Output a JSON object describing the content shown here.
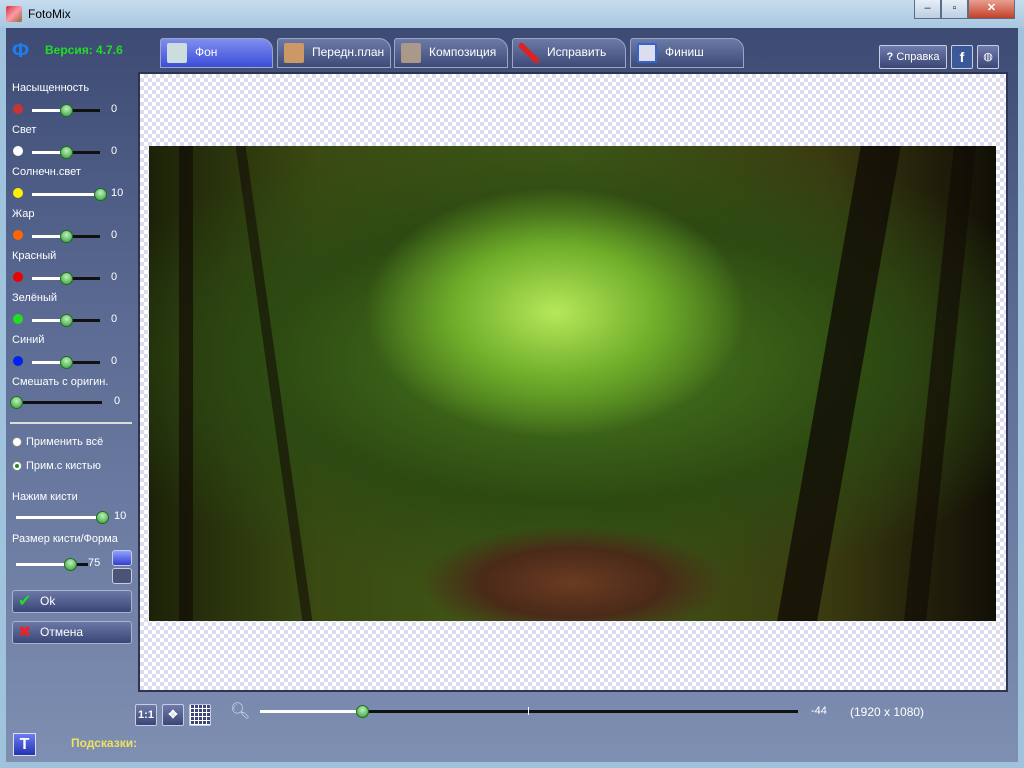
{
  "window": {
    "title": "FotoMix",
    "minimize": "–",
    "maximize": "▫",
    "close": "✕"
  },
  "app": {
    "logo": "Ф",
    "version": "Версия: 4.7.6"
  },
  "tabs": [
    {
      "label": "Фон",
      "active": true
    },
    {
      "label": "Передн.план"
    },
    {
      "label": "Композиция"
    },
    {
      "label": "Исправить"
    },
    {
      "label": "Финиш"
    }
  ],
  "right_buttons": {
    "help": "Справка",
    "facebook": "f",
    "web": "globe-icon"
  },
  "adjustments": [
    {
      "label": "Насыщенность",
      "value": "0",
      "fraction": 0.5,
      "icon_color": "#cc3333"
    },
    {
      "label": "Свет",
      "value": "0",
      "fraction": 0.5,
      "icon_color": "#ffffff"
    },
    {
      "label": "Солнечн.свет",
      "value": "10",
      "fraction": 1.0,
      "icon_color": "#ffee00"
    },
    {
      "label": "Жар",
      "value": "0",
      "fraction": 0.5,
      "icon_color": "#ff6600"
    },
    {
      "label": "Красный",
      "value": "0",
      "fraction": 0.5,
      "icon_color": "#ee0000"
    },
    {
      "label": "Зелёный",
      "value": "0",
      "fraction": 0.5,
      "icon_color": "#22dd22"
    },
    {
      "label": "Синий",
      "value": "0",
      "fraction": 0.5,
      "icon_color": "#0022ee"
    }
  ],
  "mix": {
    "label": "Смешать с оригин.",
    "value": "0",
    "fraction": 0
  },
  "apply": {
    "all": "Применить всё",
    "brush": "Прим.с кистью",
    "selected": "brush"
  },
  "brush_pressure": {
    "label": "Нажим кисти",
    "value": "10",
    "fraction": 1.0
  },
  "brush_size": {
    "label": "Размер кисти/Форма",
    "value": "75",
    "fraction": 0.75
  },
  "buttons": {
    "ok": "Ok",
    "cancel": "Отмена"
  },
  "toolbar": {
    "actual_size": "1:1",
    "zoom_value": "-44",
    "zoom_fraction": 0.19,
    "dimensions": "(1920 x 1080)"
  },
  "footer": {
    "text_button": "T",
    "hints_label": "Подсказки:"
  }
}
